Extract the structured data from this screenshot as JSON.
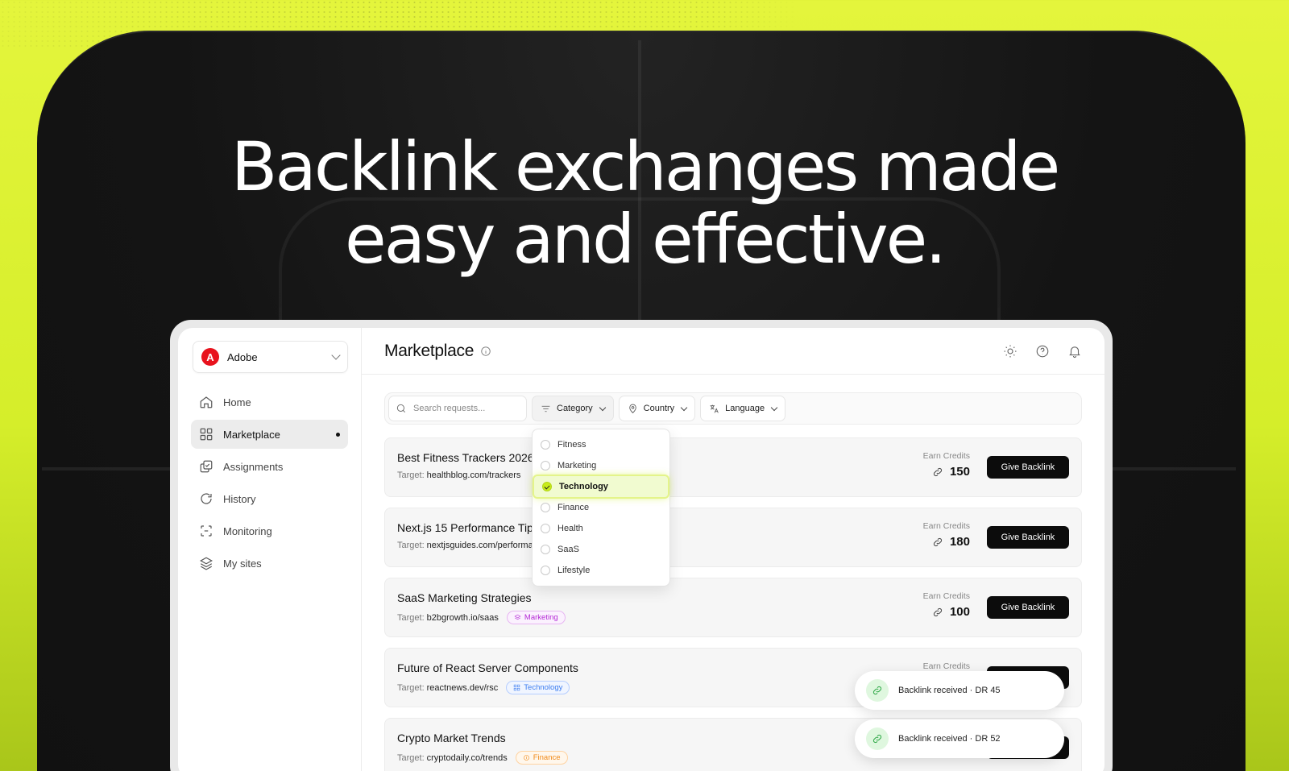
{
  "hero": {
    "headline_line1": "Backlink exchanges made",
    "headline_line2": "easy and effective."
  },
  "org": {
    "name": "Adobe",
    "logo_letter": "A"
  },
  "sidebar": {
    "items": [
      {
        "label": "Home",
        "icon": "home-icon"
      },
      {
        "label": "Marketplace",
        "icon": "grid-icon",
        "active": true
      },
      {
        "label": "Assignments",
        "icon": "assignments-icon"
      },
      {
        "label": "History",
        "icon": "history-icon"
      },
      {
        "label": "Monitoring",
        "icon": "monitoring-icon"
      },
      {
        "label": "My sites",
        "icon": "layers-icon"
      }
    ]
  },
  "header": {
    "title": "Marketplace"
  },
  "filters": {
    "search_placeholder": "Search requests...",
    "category": "Category",
    "country": "Country",
    "language": "Language"
  },
  "category_options": [
    {
      "label": "Fitness",
      "checked": false
    },
    {
      "label": "Marketing",
      "checked": false
    },
    {
      "label": "Technology",
      "checked": true
    },
    {
      "label": "Finance",
      "checked": false
    },
    {
      "label": "Health",
      "checked": false
    },
    {
      "label": "SaaS",
      "checked": false
    },
    {
      "label": "Lifestyle",
      "checked": false
    }
  ],
  "rows": [
    {
      "title": "Best Fitness Trackers 2026",
      "target_label": "Target:",
      "url": "healthblog.com/trackers",
      "credits_label": "Earn Credits",
      "credits": "150",
      "button": "Give Backlink"
    },
    {
      "title": "Next.js 15 Performance Tips",
      "target_label": "Target:",
      "url": "nextjsguides.com/performance",
      "credits_label": "Earn Credits",
      "credits": "180",
      "button": "Give Backlink"
    },
    {
      "title": "SaaS Marketing Strategies",
      "target_label": "Target:",
      "url": "b2bgrowth.io/saas",
      "tag": "Marketing",
      "credits_label": "Earn Credits",
      "credits": "100",
      "button": "Give Backlink"
    },
    {
      "title": "Future of React Server Components",
      "target_label": "Target:",
      "url": "reactnews.dev/rsc",
      "tag": "Technology",
      "credits_label": "Earn Credits"
    },
    {
      "title": "Crypto Market Trends",
      "target_label": "Target:",
      "url": "cryptodaily.co/trends",
      "tag": "Finance"
    }
  ],
  "toasts": [
    {
      "text": "Backlink received · DR 45"
    },
    {
      "text": "Backlink received · DR 52"
    }
  ],
  "colors": {
    "accent_lime": "#d5ee2a",
    "brand_red": "#e8121d",
    "button_black": "#0c0c0c",
    "success_green": "#2da745"
  }
}
